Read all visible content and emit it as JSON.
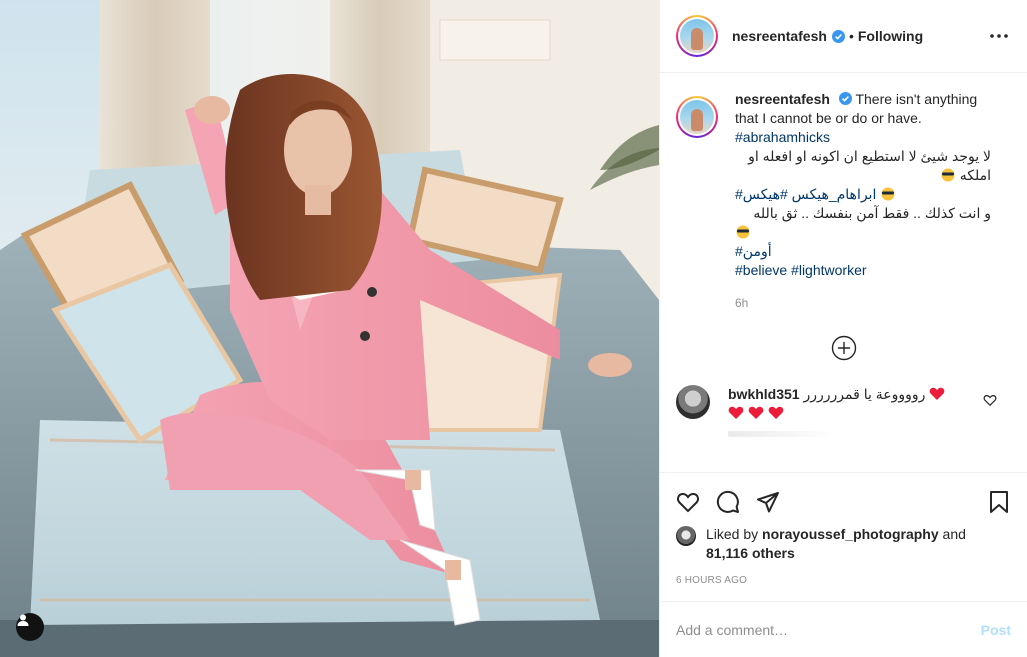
{
  "post": {
    "username": "nesreentafesh",
    "following_label": "Following",
    "separator": "•",
    "verified_icon": "verified-badge-icon",
    "more_icon": "more-options-icon"
  },
  "caption": {
    "username": "nesreentafesh",
    "text_en": "There isn't anything that I cannot be or do or have.",
    "hashtag_1": "#abrahamhicks",
    "ar_line_1": "لا يوجد شيئ لا استطيع ان اكونه او افعله او املكه",
    "ar_line_2": "ابراهام_هيكس #هيكس#",
    "ar_line_3": "و انت كذلك .. فقط آمن بنفسك .. ثق بالله",
    "hashtag_amen": "أومن#",
    "hashtag_believe": "#believe",
    "hashtag_lightworker": "#lightworker",
    "time": "6h"
  },
  "comments": [
    {
      "username": "bwkhld351",
      "text": "رووووعة يا قمرررررر"
    }
  ],
  "actions": {
    "like_icon": "heart-icon",
    "comment_icon": "comment-icon",
    "share_icon": "share-icon",
    "save_icon": "bookmark-icon"
  },
  "likes": {
    "prefix": "Liked by",
    "user": "norayoussef_photography",
    "and": "and",
    "others": "81,116 others"
  },
  "timestamp": "6 HOURS AGO",
  "add_comment": {
    "placeholder": "Add a comment…",
    "post_label": "Post"
  },
  "colors": {
    "verified": "#3897f0",
    "hashtag": "#00376b",
    "post_button_disabled": "#b2dffc",
    "heart_emoji": "#ed1c3a"
  }
}
